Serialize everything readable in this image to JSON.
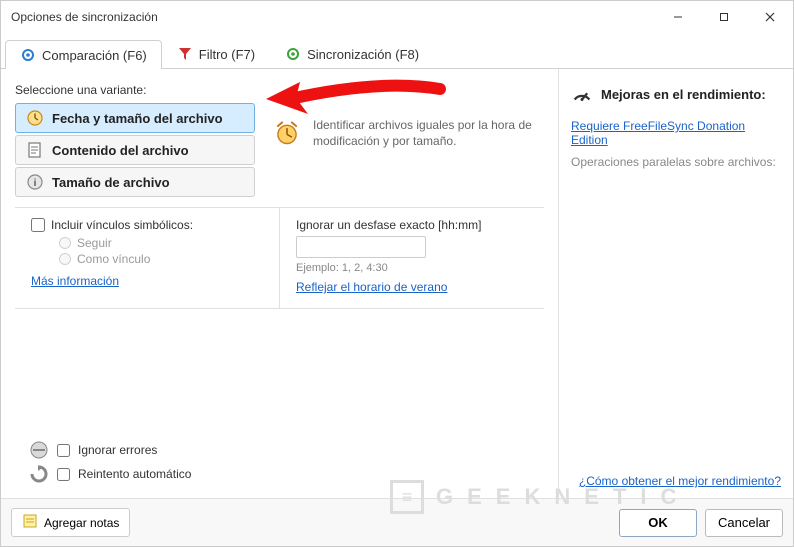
{
  "window": {
    "title": "Opciones de sincronización"
  },
  "tabs": {
    "compare": "Comparación (F6)",
    "filter": "Filtro (F7)",
    "sync": "Sincronización (F8)"
  },
  "variant": {
    "label": "Seleccione una variante:",
    "option_date_size": "Fecha y tamaño del archivo",
    "option_content": "Contenido del archivo",
    "option_size": "Tamaño de archivo",
    "description": "Identificar archivos iguales por la hora de modificación y por tamaño."
  },
  "symlinks": {
    "checkbox": "Incluir vínculos simbólicos:",
    "radio_follow": "Seguir",
    "radio_aslink": "Como vínculo",
    "more_info": "Más información"
  },
  "timeshift": {
    "label": "Ignorar un desfase exacto [hh:mm]",
    "value": "",
    "example": "Ejemplo:  1, 2, 4:30",
    "dst_link": "Reflejar el horario de verano"
  },
  "bottom": {
    "ignore_errors": "Ignorar errores",
    "auto_retry": "Reintento automático"
  },
  "sidebar": {
    "header": "Mejoras en el rendimiento:",
    "donation_link": "Requiere FreeFileSync Donation Edition",
    "parallel_text": "Operaciones paralelas sobre archivos:",
    "best_perf_link": "¿Cómo obtener el mejor rendimiento?"
  },
  "footer": {
    "notes": "Agregar notas",
    "ok": "OK",
    "cancel": "Cancelar"
  },
  "watermark": {
    "text": "GEEKNETIC"
  }
}
